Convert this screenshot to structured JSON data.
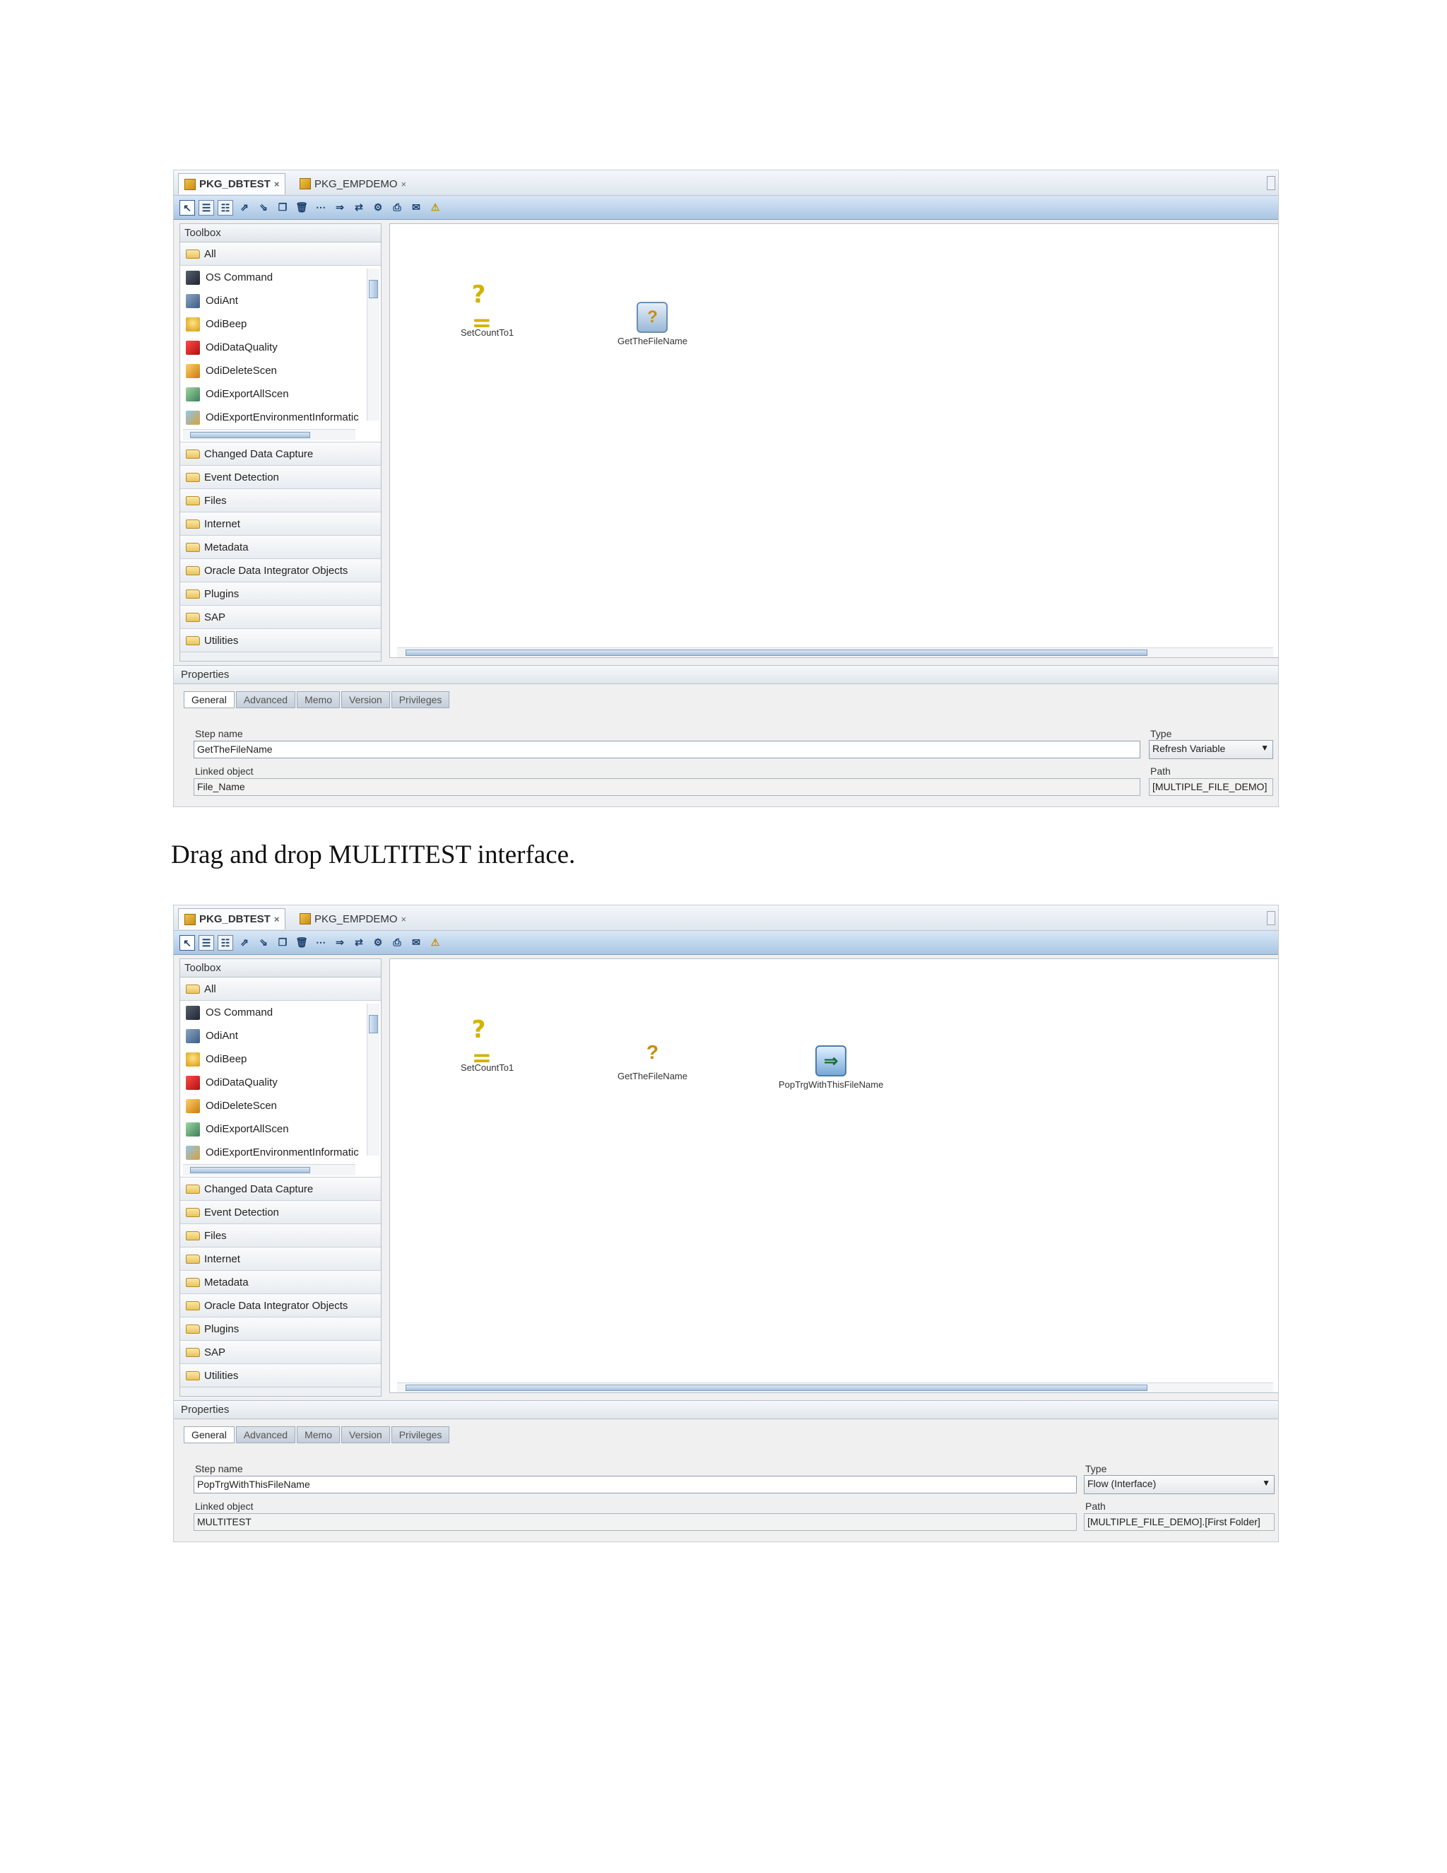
{
  "caption": "Drag and drop MULTITEST interface.",
  "common": {
    "tabs": [
      "PKG_DBTEST",
      "PKG_EMPDEMO"
    ],
    "tab_close": "×",
    "toolbox_title": "Toolbox",
    "group_all": "All",
    "items": [
      "OS Command",
      "OdiAnt",
      "OdiBeep",
      "OdiDataQuality",
      "OdiDeleteScen",
      "OdiExportAllScen",
      "OdiExportEnvironmentInformatic"
    ],
    "groups": [
      "Changed Data Capture",
      "Event Detection",
      "Files",
      "Internet",
      "Metadata",
      "Oracle Data Integrator Objects",
      "Plugins",
      "SAP",
      "Utilities"
    ],
    "properties_title": "Properties",
    "prop_tabs": [
      "General",
      "Advanced",
      "Memo",
      "Version",
      "Privileges"
    ],
    "step_name_label": "Step name",
    "linked_object_label": "Linked object",
    "type_label": "Type",
    "path_label": "Path"
  },
  "shot1": {
    "steps": [
      "SetCountTo1",
      "GetTheFileName"
    ],
    "step_name": "GetTheFileName",
    "linked_object": "File_Name",
    "type": "Refresh Variable",
    "path": "[MULTIPLE_FILE_DEMO]"
  },
  "shot2": {
    "steps": [
      "SetCountTo1",
      "GetTheFileName",
      "PopTrgWithThisFileName"
    ],
    "step_name": "PopTrgWithThisFileName",
    "linked_object": "MULTITEST",
    "type": "Flow (Interface)",
    "path": "[MULTIPLE_FILE_DEMO].[First Folder]"
  }
}
